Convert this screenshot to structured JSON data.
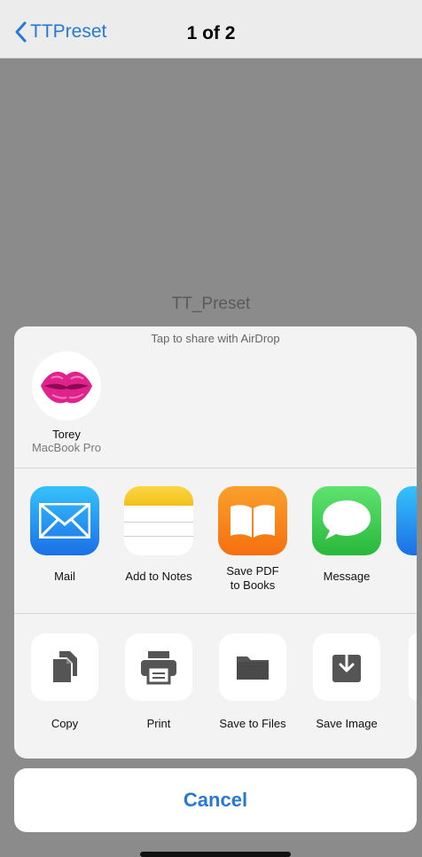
{
  "nav": {
    "back_label": "TTPreset",
    "title": "1 of 2"
  },
  "document": {
    "title": "TT_Preset"
  },
  "share": {
    "airdrop_hint": "Tap to share with AirDrop",
    "airdrop_target": {
      "name": "Torey",
      "device": "MacBook Pro",
      "avatar_icon": "lips-icon"
    },
    "apps": [
      {
        "label": "Mail",
        "icon": "mail-icon",
        "color": "#2a8cf0"
      },
      {
        "label": "Add to Notes",
        "icon": "notes-icon",
        "color": "#f4c61c"
      },
      {
        "label": "Save PDF\nto Books",
        "icon": "books-icon",
        "color": "#f7851c"
      },
      {
        "label": "Message",
        "icon": "message-icon",
        "color": "#3bc94a"
      }
    ],
    "actions": [
      {
        "label": "Copy",
        "icon": "copy-icon"
      },
      {
        "label": "Print",
        "icon": "print-icon"
      },
      {
        "label": "Save to Files",
        "icon": "folder-icon"
      },
      {
        "label": "Save Image",
        "icon": "save-image-icon"
      }
    ]
  },
  "cancel_label": "Cancel"
}
